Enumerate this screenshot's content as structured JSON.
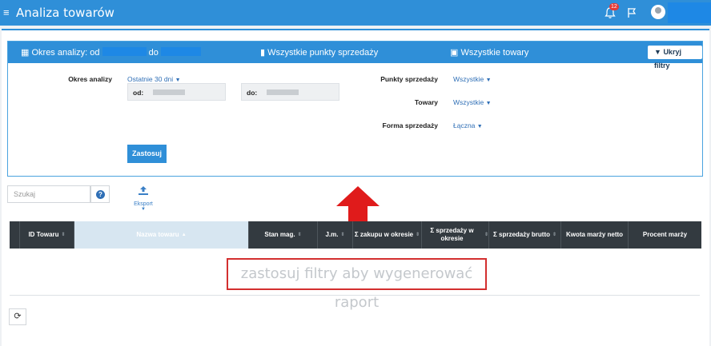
{
  "topbar": {
    "menu_glyph": "≡",
    "title": "Analiza towarów",
    "notifications_count": "12",
    "bell_icon": "bell-icon",
    "flag_icon": "flag-icon",
    "avatar_icon": "user-avatar-icon"
  },
  "filters_header": {
    "period_label_start": "Okres analizy: od",
    "period_label_mid": "do",
    "points_label": "Wszystkie punkty sprzedaży",
    "goods_label": "Wszystkie towary",
    "hide_button": "Ukryj filtry"
  },
  "filters": {
    "period_label": "Okres analizy",
    "period_select": "Ostatnie 30 dni",
    "from_label": "od:",
    "to_label": "do:",
    "points_label": "Punkty sprzedaży",
    "points_select": "Wszystkie",
    "goods_label": "Towary",
    "goods_select": "Wszystkie",
    "form_label": "Forma sprzedaży",
    "form_select": "Łączna",
    "apply_button": "Zastosuj"
  },
  "toolbar": {
    "search_placeholder": "Szukaj",
    "help_glyph": "?",
    "export_label": "Eksport"
  },
  "table": {
    "columns": [
      "ID Towaru",
      "Nazwa towaru",
      "Stan mag.",
      "J.m.",
      "Σ zakupu w okresie",
      "Σ sprzedaży w okresie",
      "Σ sprzedaży brutto",
      "Kwota marży netto",
      "Procent marży"
    ],
    "empty_message": "zastosuj filtry aby wygenerować raport"
  },
  "colors": {
    "primary": "#2f8fd8",
    "table_header": "#333a40",
    "highlight_red": "#d32f2f"
  }
}
